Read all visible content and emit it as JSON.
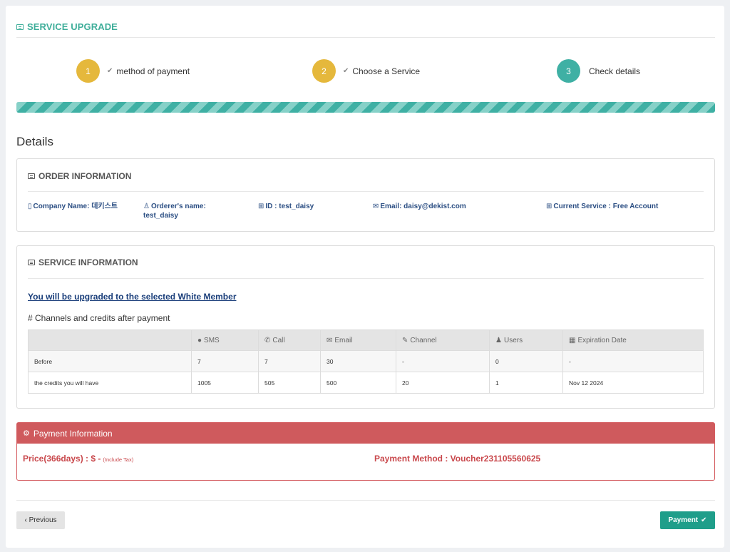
{
  "header": {
    "title": "SERVICE UPGRADE",
    "icon": "message-icon"
  },
  "steps": [
    {
      "number": "1",
      "label": "method of payment",
      "state": "done",
      "color": "#e5b83c"
    },
    {
      "number": "2",
      "label": "Choose a Service",
      "state": "done",
      "color": "#e5b83c"
    },
    {
      "number": "3",
      "label": "Check details",
      "state": "active",
      "color": "#3fb0a4"
    }
  ],
  "progress": {
    "percent": 100,
    "color": "#3fb0a4"
  },
  "details_heading": "Details",
  "order_info": {
    "title": "ORDER INFORMATION",
    "company_name": "Company Name: 데키스트",
    "orderer_name": "Orderer's name: test_daisy",
    "id": "ID : test_daisy",
    "email": "Email: daisy@dekist.com",
    "current_service": "Current Service : Free Account"
  },
  "service_info": {
    "title": "SERVICE INFORMATION",
    "upgrade_text": "You will be upgraded to the selected White Member",
    "channels_note": "# Channels and credits after payment",
    "columns": [
      "",
      "SMS",
      "Call",
      "Email",
      "Channel",
      "Users",
      "Expiration Date"
    ],
    "rows": [
      [
        "Before",
        "7",
        "7",
        "30",
        "-",
        "0",
        "-"
      ],
      [
        "the credits you will have",
        "1005",
        "505",
        "500",
        "20",
        "1",
        "Nov 12 2024"
      ]
    ]
  },
  "payment": {
    "title": "Payment Information",
    "price": "Price(366days) : $ -",
    "tax_note": "(Include Tax)",
    "method": "Payment Method : Voucher231105560625",
    "accent": "#cf5a5d"
  },
  "buttons": {
    "previous": "‹ Previous",
    "payment": "Payment"
  }
}
